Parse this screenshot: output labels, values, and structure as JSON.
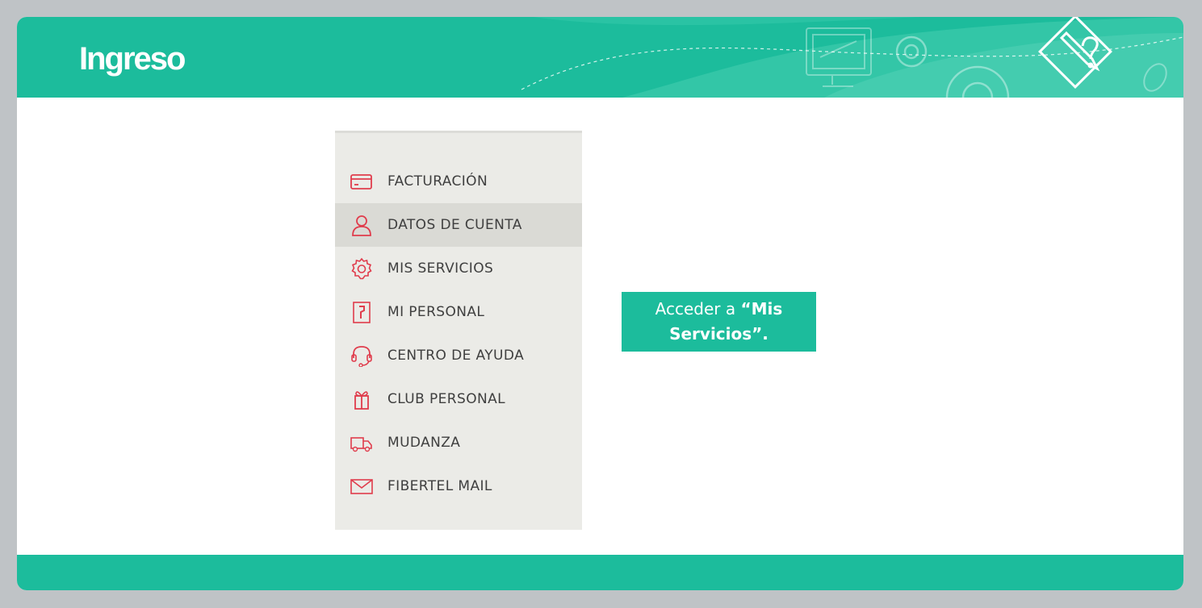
{
  "header": {
    "title": "Ingreso"
  },
  "menu": {
    "items": [
      {
        "label": "FACTURACIÓN",
        "icon": "credit-card-icon",
        "active": false
      },
      {
        "label": "DATOS DE CUENTA",
        "icon": "user-icon",
        "active": true
      },
      {
        "label": "MIS SERVICIOS",
        "icon": "gear-icon",
        "active": false
      },
      {
        "label": "MI PERSONAL",
        "icon": "personal-logo-icon",
        "active": false
      },
      {
        "label": "CENTRO DE AYUDA",
        "icon": "headset-icon",
        "active": false
      },
      {
        "label": "CLUB PERSONAL",
        "icon": "gift-icon",
        "active": false
      },
      {
        "label": "MUDANZA",
        "icon": "truck-icon",
        "active": false
      },
      {
        "label": "FIBERTEL MAIL",
        "icon": "envelope-icon",
        "active": false
      }
    ]
  },
  "callout": {
    "prefix": "Acceder a ",
    "bold_line1": "“Mis",
    "bold_line2": "Servicios”."
  },
  "colors": {
    "accent": "#1cbc9c",
    "icon": "#e03c4c",
    "menu_bg": "#ebebe7",
    "menu_active": "#dadad5"
  }
}
